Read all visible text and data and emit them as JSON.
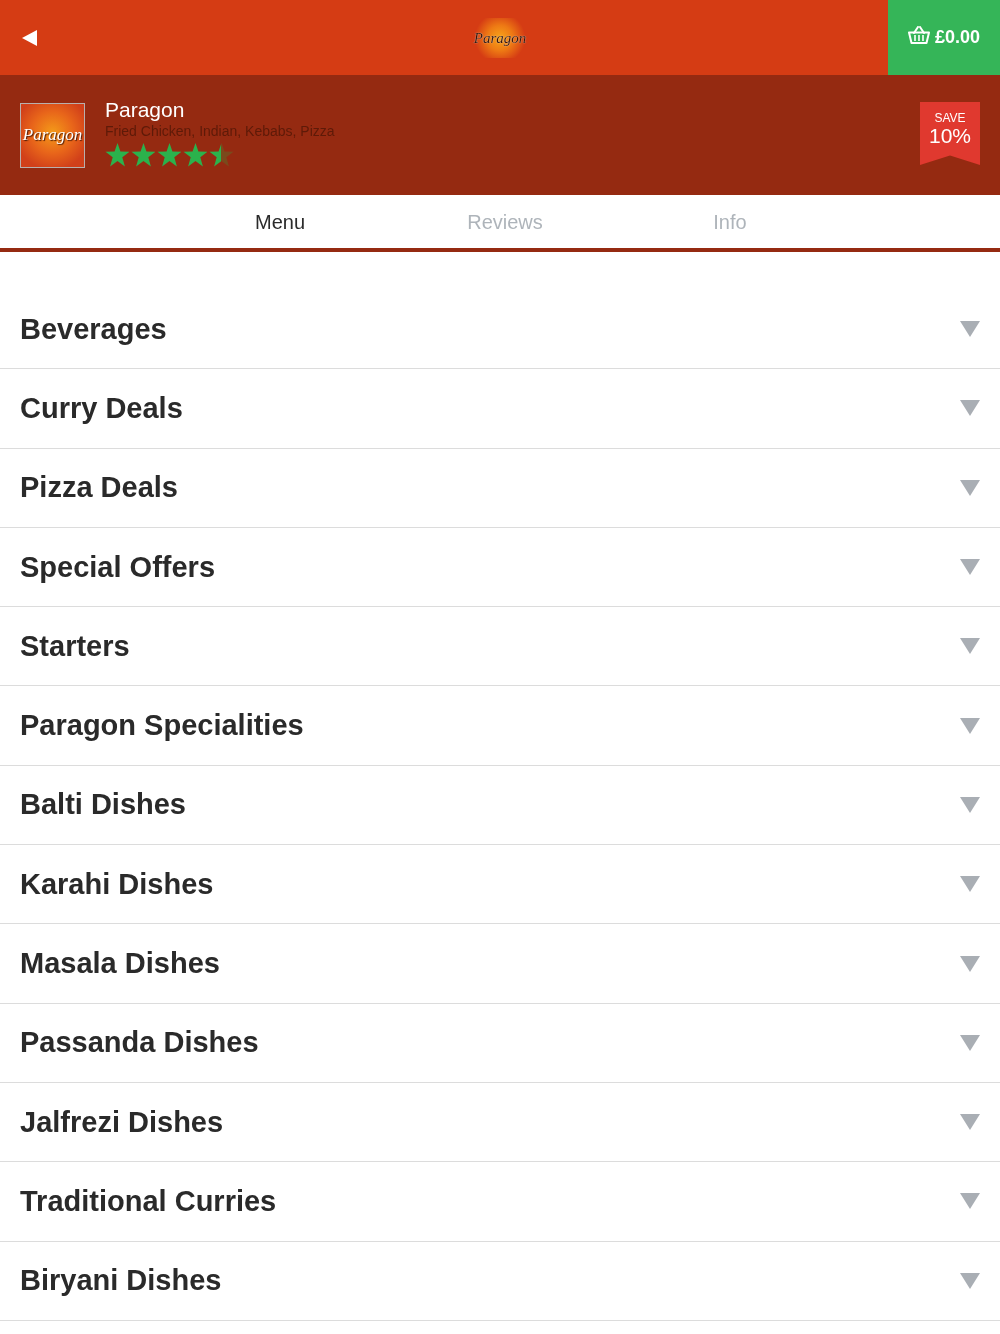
{
  "header": {
    "logo_text": "Paragon",
    "cart_total": "£0.00"
  },
  "restaurant": {
    "logo_text": "Paragon",
    "name": "Paragon",
    "cuisines": "Fried Chicken, Indian, Kebabs, Pizza",
    "stars": 4.5,
    "badge": {
      "label": "SAVE",
      "value": "10%"
    }
  },
  "tabs": [
    {
      "label": "Menu",
      "selected": true
    },
    {
      "label": "Reviews",
      "selected": false
    },
    {
      "label": "Info",
      "selected": false
    }
  ],
  "categories": [
    {
      "name": "Beverages",
      "expanded": false
    },
    {
      "name": "Curry Deals",
      "expanded": false
    },
    {
      "name": "Pizza Deals",
      "expanded": false
    },
    {
      "name": "Special Offers",
      "expanded": false
    },
    {
      "name": "Starters",
      "expanded": false
    },
    {
      "name": "Paragon Specialities",
      "expanded": false
    },
    {
      "name": "Balti Dishes",
      "expanded": false
    },
    {
      "name": "Karahi Dishes",
      "expanded": false
    },
    {
      "name": "Masala Dishes",
      "expanded": false
    },
    {
      "name": "Passanda Dishes",
      "expanded": false
    },
    {
      "name": "Jalfrezi Dishes",
      "expanded": false
    },
    {
      "name": "Traditional Curries",
      "expanded": false
    },
    {
      "name": "Biryani Dishes",
      "expanded": false
    }
  ]
}
